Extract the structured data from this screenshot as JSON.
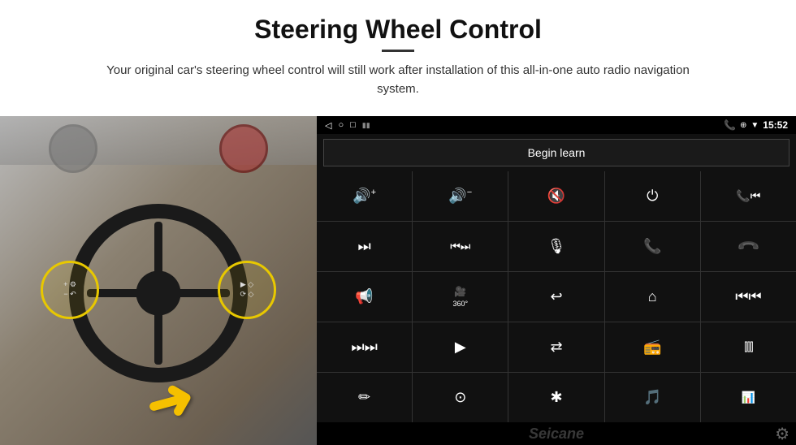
{
  "header": {
    "title": "Steering Wheel Control",
    "subtitle": "Your original car's steering wheel control will still work after installation of this all-in-one auto radio navigation system."
  },
  "screen": {
    "status_bar": {
      "back_icon": "◁",
      "home_icon": "○",
      "recent_icon": "□",
      "time": "15:52",
      "phone_icon": "📞",
      "location_icon": "⊕",
      "wifi_icon": "▼",
      "battery_icon": "▮▮"
    },
    "begin_learn_label": "Begin learn",
    "watermark": "Seicane",
    "controls": [
      {
        "icon": "🔊+",
        "label": "vol-up"
      },
      {
        "icon": "🔊−",
        "label": "vol-down"
      },
      {
        "icon": "🔇",
        "label": "mute"
      },
      {
        "icon": "⏻",
        "label": "power"
      },
      {
        "icon": "⏮",
        "label": "prev-track-phone"
      },
      {
        "icon": "⏭",
        "label": "next"
      },
      {
        "icon": "⏮⏭",
        "label": "seek"
      },
      {
        "icon": "🎙",
        "label": "mic"
      },
      {
        "icon": "📞",
        "label": "call"
      },
      {
        "icon": "↩",
        "label": "hang-up"
      },
      {
        "icon": "📢",
        "label": "horn"
      },
      {
        "icon": "360",
        "label": "camera-360"
      },
      {
        "icon": "↶",
        "label": "back"
      },
      {
        "icon": "⌂",
        "label": "home"
      },
      {
        "icon": "⏮⏮",
        "label": "fast-prev"
      },
      {
        "icon": "⏭⏭",
        "label": "fast-next"
      },
      {
        "icon": "▶",
        "label": "play"
      },
      {
        "icon": "⇌",
        "label": "source"
      },
      {
        "icon": "📻",
        "label": "radio"
      },
      {
        "icon": "|||",
        "label": "eq"
      },
      {
        "icon": "✏",
        "label": "settings-steer"
      },
      {
        "icon": "⊙",
        "label": "menu"
      },
      {
        "icon": "✱",
        "label": "bluetooth"
      },
      {
        "icon": "♪",
        "label": "music"
      },
      {
        "icon": "|||",
        "label": "eq2"
      }
    ]
  }
}
